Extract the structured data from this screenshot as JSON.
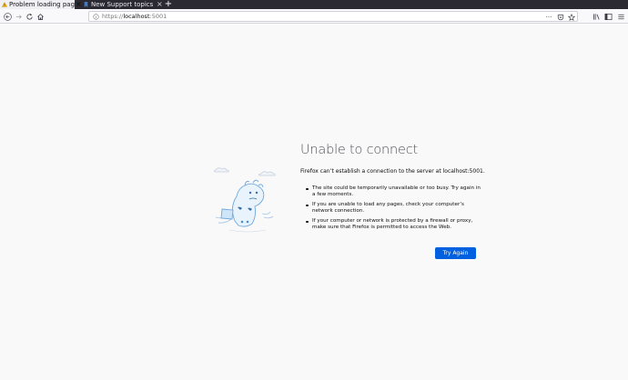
{
  "tabs": [
    {
      "title": "Problem loading page",
      "active": true
    },
    {
      "title": "New Support topics - Sq",
      "active": false
    }
  ],
  "tab_close_glyph": "×",
  "new_tab_glyph": "+",
  "url": {
    "scheme": "https://",
    "host": "localhost",
    "port": ":5001"
  },
  "url_more_glyph": "···",
  "error": {
    "title": "Unable to connect",
    "description": "Firefox can’t establish a connection to the server at localhost:5001.",
    "suggestions": [
      "The site could be temporarily unavailable or too busy. Try again in a few moments.",
      "If you are unable to load any pages, check your computer’s network connection.",
      "If your computer or network is protected by a firewall or proxy, make sure that Firefox is permitted to access the Web."
    ],
    "button_label": "Try Again"
  },
  "colors": {
    "primary_button": "#0060df",
    "tabstrip": "#2b2a33",
    "page_bg": "#f9f9fa"
  },
  "icons": [
    "warning-favicon-icon",
    "site-favicon-icon",
    "back-icon",
    "forward-icon",
    "reload-icon",
    "home-icon",
    "info-icon",
    "page-actions-icon",
    "pocket-icon",
    "bookmark-star-icon",
    "library-icon",
    "sidebar-icon",
    "menu-icon"
  ]
}
